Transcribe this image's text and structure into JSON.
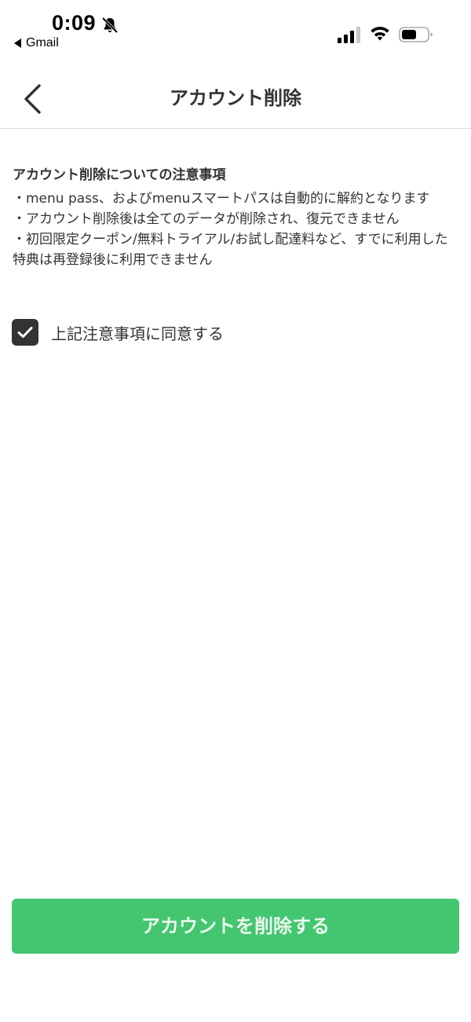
{
  "status_bar": {
    "time": "0:09",
    "back_app": "Gmail",
    "icons": [
      "bell-slash-icon",
      "cellular-signal-icon",
      "wifi-icon",
      "battery-icon"
    ]
  },
  "nav": {
    "back_icon": "chevron-left-icon",
    "title": "アカウント削除"
  },
  "notice": {
    "heading": "アカウント削除についての注意事項",
    "items": [
      "・menu pass、およびmenuスマートパスは自動的に解約となります",
      "・アカウント削除後は全てのデータが削除され、復元できません",
      "・初回限定クーポン/無料トライアル/お試し配達料など、すでに利用した特典は再登録後に利用できません"
    ]
  },
  "agreement": {
    "checked": true,
    "label": "上記注意事項に同意する"
  },
  "delete_button": {
    "label": "アカウントを削除する"
  },
  "colors": {
    "accent_green": "#44c670",
    "text_primary": "#333333",
    "checkbox_fill": "#333333",
    "divider": "#d9d9d9"
  }
}
